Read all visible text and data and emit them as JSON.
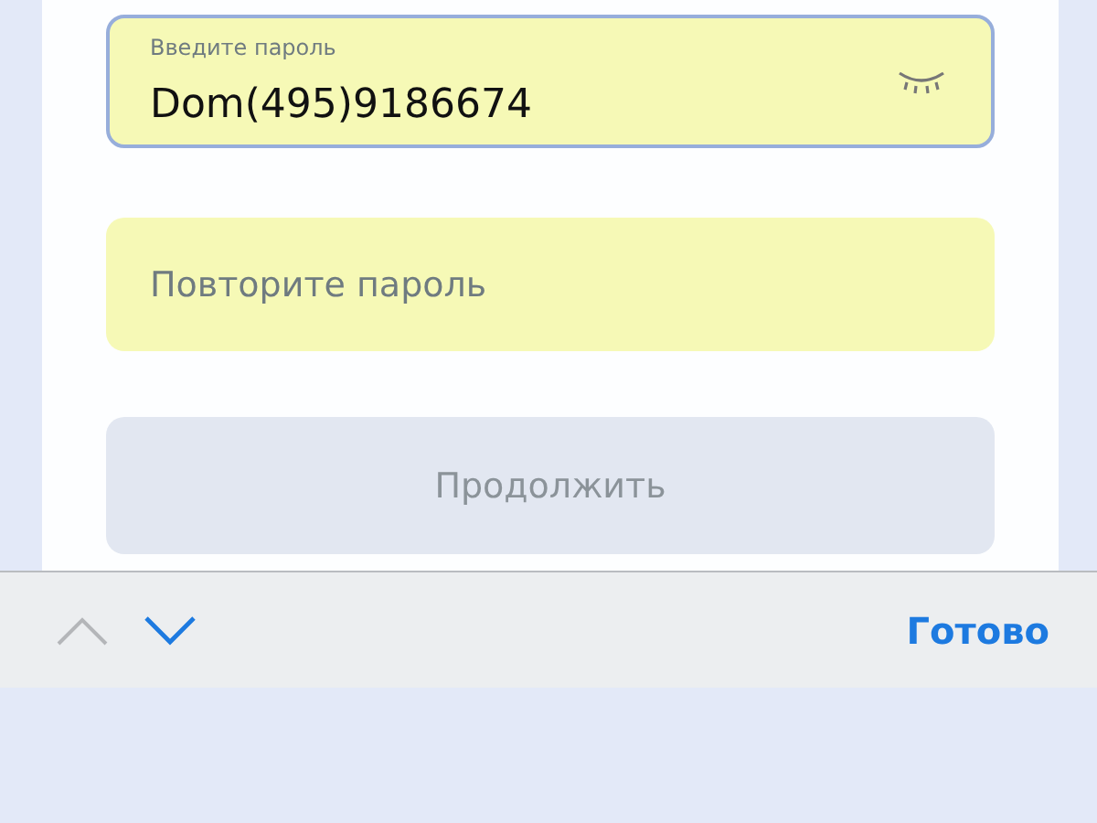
{
  "password_field": {
    "label": "Введите пароль",
    "value": "Dom(495)9186674",
    "focused": true
  },
  "repeat_field": {
    "placeholder": "Повторите пароль",
    "focused": false
  },
  "continue_button": {
    "label": "Продолжить",
    "disabled": true
  },
  "keyboard_toolbar": {
    "previous_disabled": true,
    "next_disabled": false,
    "done": "Готово"
  }
}
